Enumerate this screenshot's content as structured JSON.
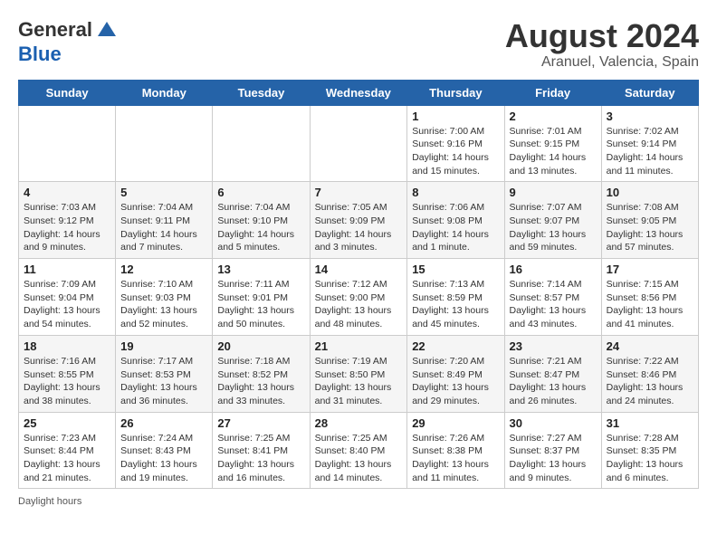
{
  "header": {
    "logo_general": "General",
    "logo_blue": "Blue",
    "month_year": "August 2024",
    "location": "Aranuel, Valencia, Spain"
  },
  "days_of_week": [
    "Sunday",
    "Monday",
    "Tuesday",
    "Wednesday",
    "Thursday",
    "Friday",
    "Saturday"
  ],
  "weeks": [
    [
      {
        "day": "",
        "info": ""
      },
      {
        "day": "",
        "info": ""
      },
      {
        "day": "",
        "info": ""
      },
      {
        "day": "",
        "info": ""
      },
      {
        "day": "1",
        "info": "Sunrise: 7:00 AM\nSunset: 9:16 PM\nDaylight: 14 hours and 15 minutes."
      },
      {
        "day": "2",
        "info": "Sunrise: 7:01 AM\nSunset: 9:15 PM\nDaylight: 14 hours and 13 minutes."
      },
      {
        "day": "3",
        "info": "Sunrise: 7:02 AM\nSunset: 9:14 PM\nDaylight: 14 hours and 11 minutes."
      }
    ],
    [
      {
        "day": "4",
        "info": "Sunrise: 7:03 AM\nSunset: 9:12 PM\nDaylight: 14 hours and 9 minutes."
      },
      {
        "day": "5",
        "info": "Sunrise: 7:04 AM\nSunset: 9:11 PM\nDaylight: 14 hours and 7 minutes."
      },
      {
        "day": "6",
        "info": "Sunrise: 7:04 AM\nSunset: 9:10 PM\nDaylight: 14 hours and 5 minutes."
      },
      {
        "day": "7",
        "info": "Sunrise: 7:05 AM\nSunset: 9:09 PM\nDaylight: 14 hours and 3 minutes."
      },
      {
        "day": "8",
        "info": "Sunrise: 7:06 AM\nSunset: 9:08 PM\nDaylight: 14 hours and 1 minute."
      },
      {
        "day": "9",
        "info": "Sunrise: 7:07 AM\nSunset: 9:07 PM\nDaylight: 13 hours and 59 minutes."
      },
      {
        "day": "10",
        "info": "Sunrise: 7:08 AM\nSunset: 9:05 PM\nDaylight: 13 hours and 57 minutes."
      }
    ],
    [
      {
        "day": "11",
        "info": "Sunrise: 7:09 AM\nSunset: 9:04 PM\nDaylight: 13 hours and 54 minutes."
      },
      {
        "day": "12",
        "info": "Sunrise: 7:10 AM\nSunset: 9:03 PM\nDaylight: 13 hours and 52 minutes."
      },
      {
        "day": "13",
        "info": "Sunrise: 7:11 AM\nSunset: 9:01 PM\nDaylight: 13 hours and 50 minutes."
      },
      {
        "day": "14",
        "info": "Sunrise: 7:12 AM\nSunset: 9:00 PM\nDaylight: 13 hours and 48 minutes."
      },
      {
        "day": "15",
        "info": "Sunrise: 7:13 AM\nSunset: 8:59 PM\nDaylight: 13 hours and 45 minutes."
      },
      {
        "day": "16",
        "info": "Sunrise: 7:14 AM\nSunset: 8:57 PM\nDaylight: 13 hours and 43 minutes."
      },
      {
        "day": "17",
        "info": "Sunrise: 7:15 AM\nSunset: 8:56 PM\nDaylight: 13 hours and 41 minutes."
      }
    ],
    [
      {
        "day": "18",
        "info": "Sunrise: 7:16 AM\nSunset: 8:55 PM\nDaylight: 13 hours and 38 minutes."
      },
      {
        "day": "19",
        "info": "Sunrise: 7:17 AM\nSunset: 8:53 PM\nDaylight: 13 hours and 36 minutes."
      },
      {
        "day": "20",
        "info": "Sunrise: 7:18 AM\nSunset: 8:52 PM\nDaylight: 13 hours and 33 minutes."
      },
      {
        "day": "21",
        "info": "Sunrise: 7:19 AM\nSunset: 8:50 PM\nDaylight: 13 hours and 31 minutes."
      },
      {
        "day": "22",
        "info": "Sunrise: 7:20 AM\nSunset: 8:49 PM\nDaylight: 13 hours and 29 minutes."
      },
      {
        "day": "23",
        "info": "Sunrise: 7:21 AM\nSunset: 8:47 PM\nDaylight: 13 hours and 26 minutes."
      },
      {
        "day": "24",
        "info": "Sunrise: 7:22 AM\nSunset: 8:46 PM\nDaylight: 13 hours and 24 minutes."
      }
    ],
    [
      {
        "day": "25",
        "info": "Sunrise: 7:23 AM\nSunset: 8:44 PM\nDaylight: 13 hours and 21 minutes."
      },
      {
        "day": "26",
        "info": "Sunrise: 7:24 AM\nSunset: 8:43 PM\nDaylight: 13 hours and 19 minutes."
      },
      {
        "day": "27",
        "info": "Sunrise: 7:25 AM\nSunset: 8:41 PM\nDaylight: 13 hours and 16 minutes."
      },
      {
        "day": "28",
        "info": "Sunrise: 7:25 AM\nSunset: 8:40 PM\nDaylight: 13 hours and 14 minutes."
      },
      {
        "day": "29",
        "info": "Sunrise: 7:26 AM\nSunset: 8:38 PM\nDaylight: 13 hours and 11 minutes."
      },
      {
        "day": "30",
        "info": "Sunrise: 7:27 AM\nSunset: 8:37 PM\nDaylight: 13 hours and 9 minutes."
      },
      {
        "day": "31",
        "info": "Sunrise: 7:28 AM\nSunset: 8:35 PM\nDaylight: 13 hours and 6 minutes."
      }
    ]
  ],
  "footer": {
    "daylight_label": "Daylight hours"
  }
}
